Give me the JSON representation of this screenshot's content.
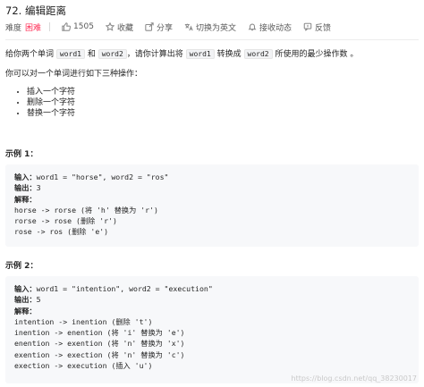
{
  "problem": {
    "title": "72. 编辑距离",
    "difficulty_label": "难度",
    "difficulty": "困难",
    "likes": "1505",
    "favorite_label": "收藏",
    "share_label": "分享",
    "switch_lang_label": "切换为英文",
    "notify_label": "接收动态",
    "feedback_label": "反馈",
    "accent_color": "#ff2d55"
  },
  "description": {
    "p1_a": "给你两个单词 ",
    "word1": "word1",
    "p1_b": " 和 ",
    "word2": "word2",
    "p1_c": "，请你计算出将 ",
    "word1_b": "word1",
    "p1_d": " 转换成 ",
    "word2_b": "word2",
    "p1_e": " 所使用的最少操作数 。",
    "p2": "你可以对一个单词进行如下三种操作：",
    "ops": [
      "插入一个字符",
      "删除一个字符",
      "替换一个字符"
    ]
  },
  "examples": [
    {
      "title": "示例 1：",
      "input_label": "输入：",
      "input": "word1 = \"horse\", word2 = \"ros\"",
      "output_label": "输出：",
      "output": "3",
      "explain_label": "解释：",
      "steps": [
        "horse -> rorse (将 'h' 替换为 'r')",
        "rorse -> rose (删除 'r')",
        "rose -> ros (删除 'e')"
      ]
    },
    {
      "title": "示例 2：",
      "input_label": "输入：",
      "input": "word1 = \"intention\", word2 = \"execution\"",
      "output_label": "输出：",
      "output": "5",
      "explain_label": "解释：",
      "steps": [
        "intention -> inention (删除 't')",
        "inention -> enention (将 'i' 替换为 'e')",
        "enention -> exention (将 'n' 替换为 'x')",
        "exention -> exection (将 'n' 替换为 'c')",
        "exection -> execution (插入 'u')"
      ]
    }
  ],
  "watermark": "https://blog.csdn.net/qq_38230017"
}
